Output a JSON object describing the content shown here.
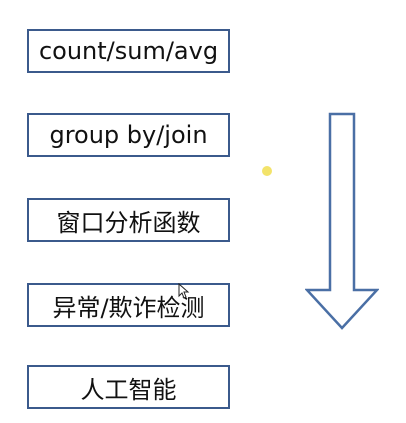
{
  "stages": [
    {
      "label": "count/sum/avg"
    },
    {
      "label": "group by/join"
    },
    {
      "label": "窗口分析函数"
    },
    {
      "label": "异常/欺诈检测"
    },
    {
      "label": "人工智能"
    }
  ],
  "colors": {
    "box_border": "#3b5a8c",
    "arrow_stroke": "#4a6fa5",
    "dot": "#f3e36a"
  },
  "icons": {
    "arrow": "down-arrow-icon",
    "pointer": "mouse-cursor-icon"
  }
}
